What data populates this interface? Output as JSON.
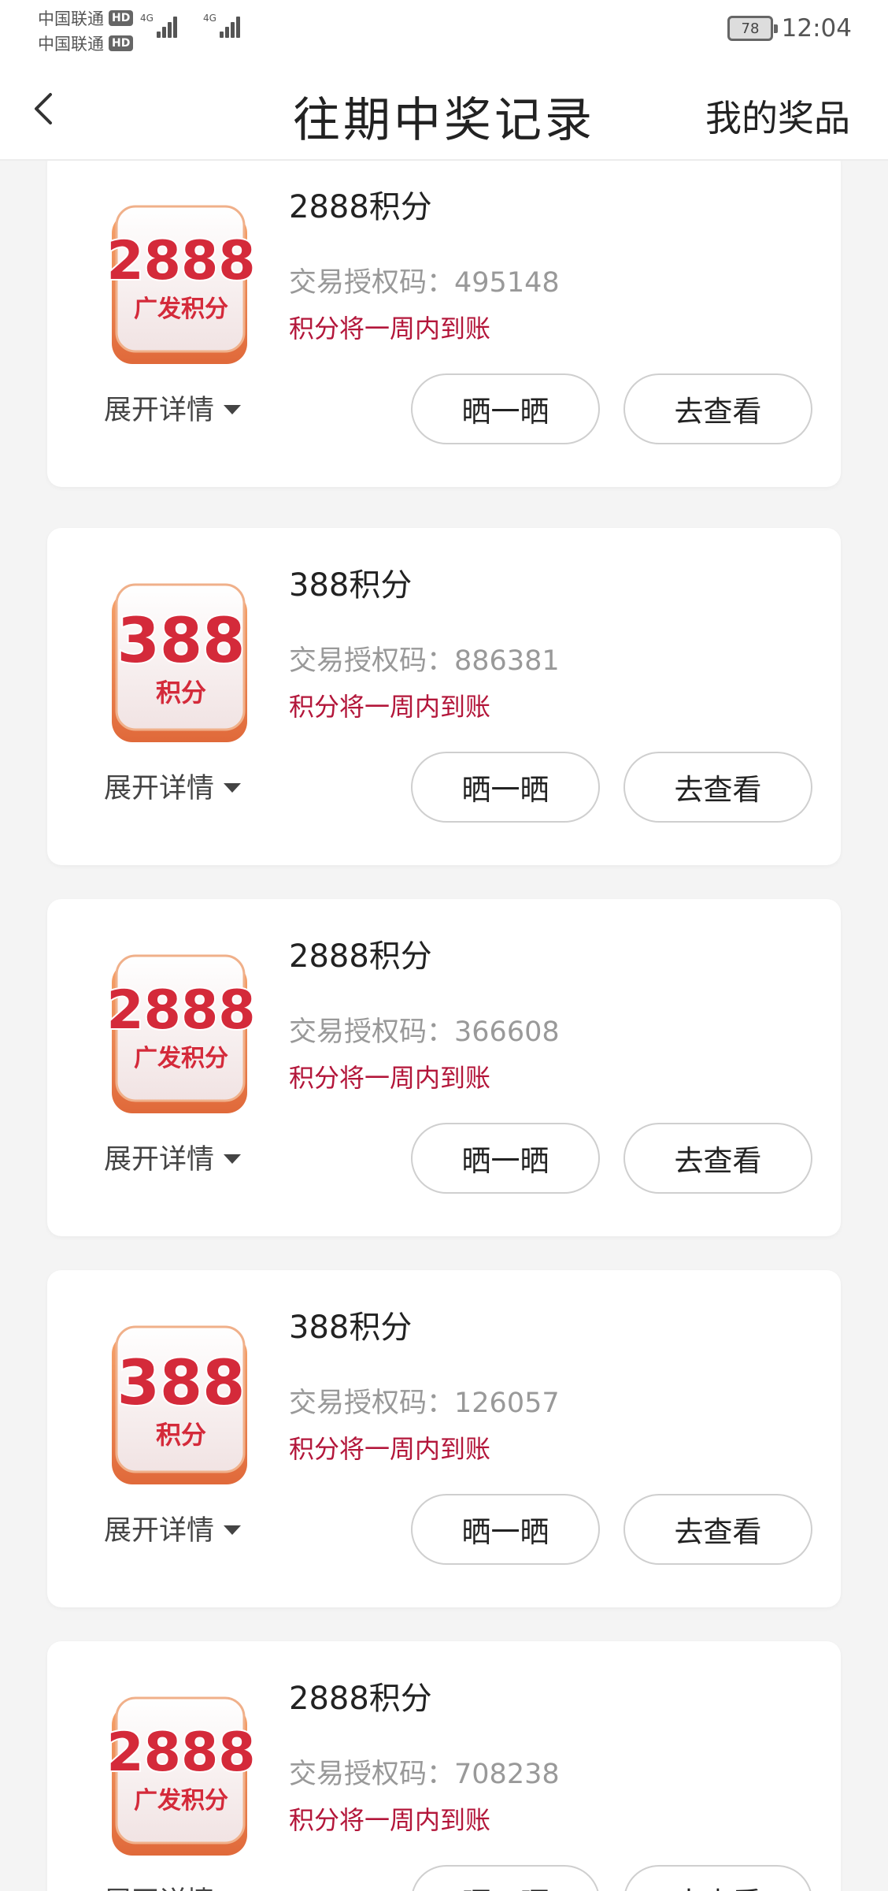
{
  "status_bar": {
    "carrier_1": "中国联通",
    "carrier_2": "中国联通",
    "hd_badge": "HD",
    "network_1": "4G",
    "network_2": "4G",
    "battery": "78",
    "time": "12:04"
  },
  "header": {
    "back_icon": "chevron-left-icon",
    "title": "往期中奖记录",
    "right_link": "我的奖品"
  },
  "prizes": [
    {
      "name": "2888积分",
      "badge_number": "2888",
      "badge_text": "广发积分",
      "auth_label": "交易授权码：",
      "auth_code": "495148",
      "note": "积分将一周内到账",
      "expand_label": "展开详情",
      "share_label": "晒一晒",
      "view_label": "去查看"
    },
    {
      "name": "388积分",
      "badge_number": "388",
      "badge_text": "积分",
      "auth_label": "交易授权码：",
      "auth_code": "886381",
      "note": "积分将一周内到账",
      "expand_label": "展开详情",
      "share_label": "晒一晒",
      "view_label": "去查看"
    },
    {
      "name": "2888积分",
      "badge_number": "2888",
      "badge_text": "广发积分",
      "auth_label": "交易授权码：",
      "auth_code": "366608",
      "note": "积分将一周内到账",
      "expand_label": "展开详情",
      "share_label": "晒一晒",
      "view_label": "去查看"
    },
    {
      "name": "388积分",
      "badge_number": "388",
      "badge_text": "积分",
      "auth_label": "交易授权码：",
      "auth_code": "126057",
      "note": "积分将一周内到账",
      "expand_label": "展开详情",
      "share_label": "晒一晒",
      "view_label": "去查看"
    },
    {
      "name": "2888积分",
      "badge_number": "2888",
      "badge_text": "广发积分",
      "auth_label": "交易授权码：",
      "auth_code": "708238",
      "note": "积分将一周内到账",
      "expand_label": "展开详情",
      "share_label": "晒一晒",
      "view_label": "去查看"
    }
  ],
  "colors": {
    "accent_red": "#b3163a",
    "badge_red": "#d42a3a",
    "badge_orange": "#f08a4b",
    "page_background": "#f4f4f4"
  }
}
